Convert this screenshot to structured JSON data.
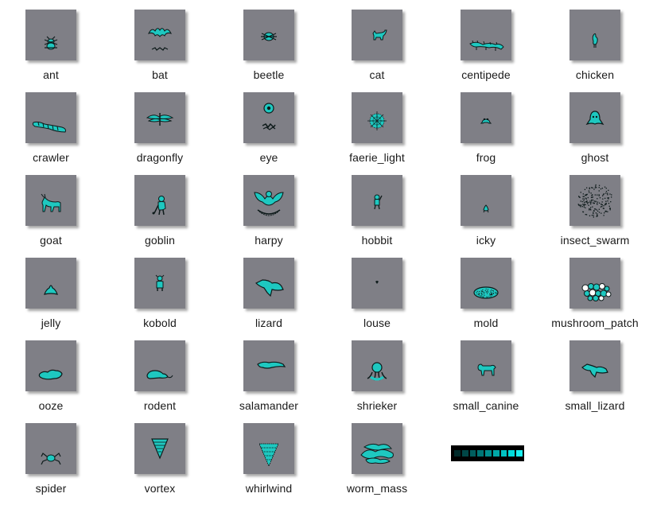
{
  "sprites": [
    {
      "label": "ant",
      "icon": "ant-icon"
    },
    {
      "label": "bat",
      "icon": "bat-icon"
    },
    {
      "label": "beetle",
      "icon": "beetle-icon"
    },
    {
      "label": "cat",
      "icon": "cat-icon"
    },
    {
      "label": "centipede",
      "icon": "centipede-icon"
    },
    {
      "label": "chicken",
      "icon": "chicken-icon"
    },
    {
      "label": "crawler",
      "icon": "crawler-icon"
    },
    {
      "label": "dragonfly",
      "icon": "dragonfly-icon"
    },
    {
      "label": "eye",
      "icon": "eye-icon"
    },
    {
      "label": "faerie_light",
      "icon": "faerie-light-icon"
    },
    {
      "label": "frog",
      "icon": "frog-icon"
    },
    {
      "label": "ghost",
      "icon": "ghost-icon"
    },
    {
      "label": "goat",
      "icon": "goat-icon"
    },
    {
      "label": "goblin",
      "icon": "goblin-icon"
    },
    {
      "label": "harpy",
      "icon": "harpy-icon"
    },
    {
      "label": "hobbit",
      "icon": "hobbit-icon"
    },
    {
      "label": "icky",
      "icon": "icky-icon"
    },
    {
      "label": "insect_swarm",
      "icon": "insect-swarm-icon"
    },
    {
      "label": "jelly",
      "icon": "jelly-icon"
    },
    {
      "label": "kobold",
      "icon": "kobold-icon"
    },
    {
      "label": "lizard",
      "icon": "lizard-icon"
    },
    {
      "label": "louse",
      "icon": "louse-icon"
    },
    {
      "label": "mold",
      "icon": "mold-icon"
    },
    {
      "label": "mushroom_patch",
      "icon": "mushroom-patch-icon"
    },
    {
      "label": "ooze",
      "icon": "ooze-icon"
    },
    {
      "label": "rodent",
      "icon": "rodent-icon"
    },
    {
      "label": "salamander",
      "icon": "salamander-icon"
    },
    {
      "label": "shrieker",
      "icon": "shrieker-icon"
    },
    {
      "label": "small_canine",
      "icon": "small-canine-icon"
    },
    {
      "label": "small_lizard",
      "icon": "small-lizard-icon"
    },
    {
      "label": "spider",
      "icon": "spider-icon"
    },
    {
      "label": "vortex",
      "icon": "vortex-icon"
    },
    {
      "label": "whirlwind",
      "icon": "whirlwind-icon"
    },
    {
      "label": "worm_mass",
      "icon": "worm-mass-icon"
    }
  ],
  "palette": {
    "icon": "palette-strip-icon",
    "colors": [
      "#002a2a",
      "#004646",
      "#005e5e",
      "#007676",
      "#008f8f",
      "#00a8a8",
      "#00c2c2",
      "#00dcdc",
      "#19f0f0"
    ]
  },
  "colors": {
    "thumb_bg": "#7f7f86",
    "sprite_fill": "#1ec8c0",
    "sprite_outline": "#0d1a1a"
  }
}
